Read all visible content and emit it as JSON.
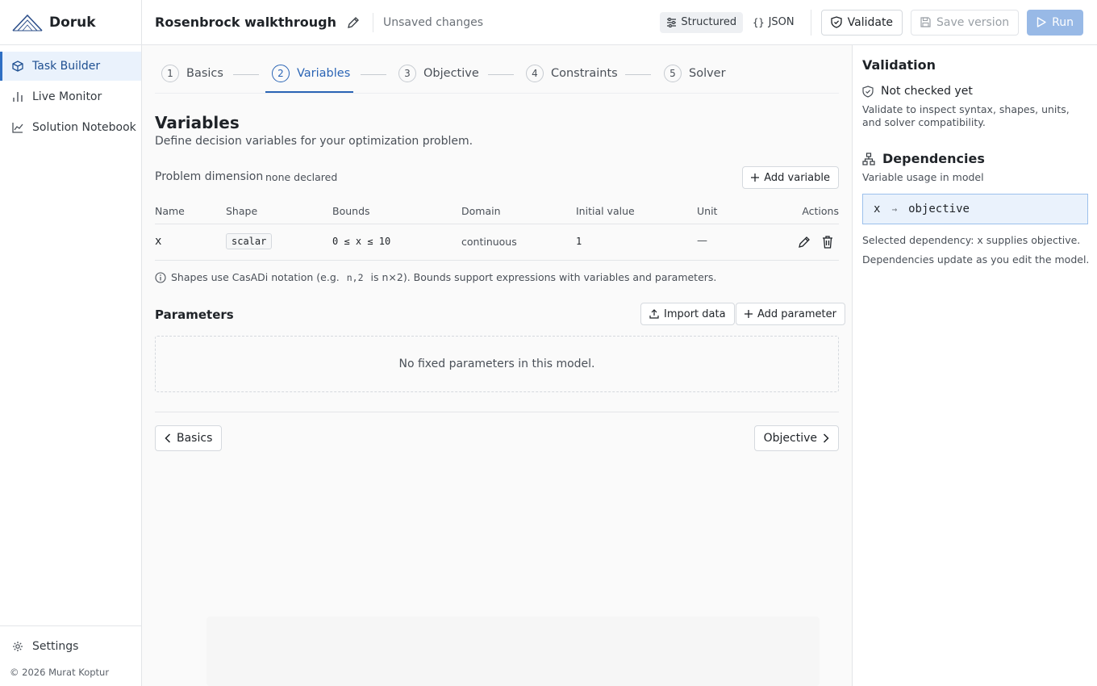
{
  "app": {
    "name": "Doruk"
  },
  "sidebar": {
    "items": [
      {
        "label": "Task Builder",
        "icon": "cube-icon",
        "active": true
      },
      {
        "label": "Live Monitor",
        "icon": "bar-chart-icon",
        "active": false
      },
      {
        "label": "Solution Notebook",
        "icon": "line-chart-icon",
        "active": false
      }
    ],
    "settings_label": "Settings",
    "copyright": "© 2026 Murat Koptur"
  },
  "topbar": {
    "title": "Rosenbrock walkthrough",
    "status": "Unsaved changes",
    "view_structured": "Structured",
    "view_json": "JSON",
    "validate_label": "Validate",
    "save_label": "Save version",
    "run_label": "Run"
  },
  "stepper": {
    "steps": [
      {
        "num": "1",
        "label": "Basics"
      },
      {
        "num": "2",
        "label": "Variables",
        "active": true
      },
      {
        "num": "3",
        "label": "Objective"
      },
      {
        "num": "4",
        "label": "Constraints"
      },
      {
        "num": "5",
        "label": "Solver"
      }
    ]
  },
  "variables": {
    "title": "Variables",
    "description": "Define decision variables for your optimization problem.",
    "dimension_label": "Problem dimension",
    "dimension_value": "none declared",
    "add_label": "Add variable",
    "columns": [
      "Name",
      "Shape",
      "Bounds",
      "Domain",
      "Initial value",
      "Unit",
      "Actions"
    ],
    "rows": [
      {
        "name": "x",
        "shape": "scalar",
        "bounds": "0 ≤ x ≤ 10",
        "domain": "continuous",
        "initial": "1",
        "unit": "—"
      }
    ],
    "hint_pre": "Shapes use CasADi notation (e.g.",
    "hint_code": "n,2",
    "hint_post": "is n×2). Bounds support expressions with variables and parameters."
  },
  "parameters": {
    "title": "Parameters",
    "import_label": "Import data",
    "add_label": "Add parameter",
    "empty_text": "No fixed parameters in this model."
  },
  "nav_footer": {
    "back_label": "Basics",
    "next_label": "Objective"
  },
  "validation": {
    "title": "Validation",
    "status": "Not checked yet",
    "help": "Validate to inspect syntax, shapes, units, and solver compatibility."
  },
  "dependencies": {
    "title": "Dependencies",
    "subtitle": "Variable usage in model",
    "from": "x",
    "arrow": "→",
    "to": "objective",
    "selected": "Selected dependency: x supplies objective.",
    "note": "Dependencies update as you edit the model."
  },
  "colors": {
    "accent": "#2a64b5",
    "active_bg": "#eaf2fc",
    "run_disabled": "#98b9e6"
  }
}
